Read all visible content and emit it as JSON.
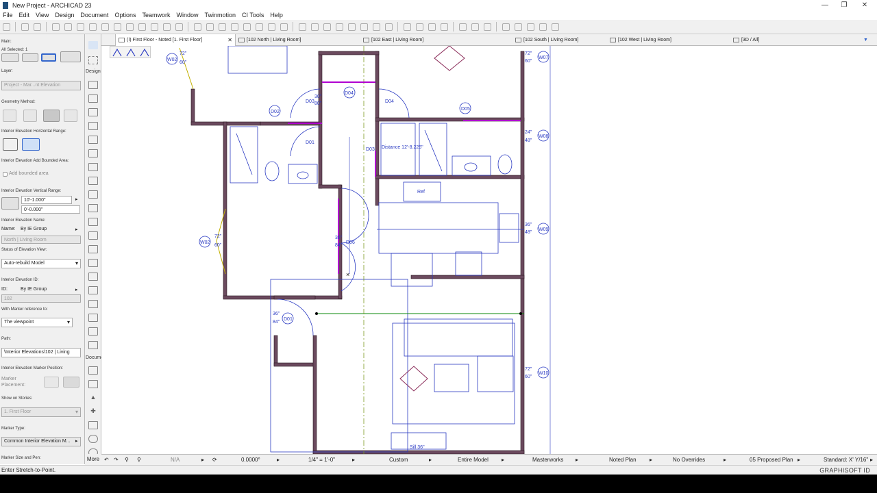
{
  "window": {
    "title": "New Project - ARCHICAD 23"
  },
  "menu": [
    "File",
    "Edit",
    "View",
    "Design",
    "Document",
    "Options",
    "Teamwork",
    "Window",
    "Twinmotion",
    "CI Tools",
    "Help"
  ],
  "infobox": {
    "main_label": "Main:",
    "selected": "All Selected: 1",
    "layer_label": "Layer:",
    "layer_value": "Project - Mar...nt Elevation",
    "geometry_label": "Geometry Method:",
    "horiz_range_label": "Interior Elevation Horizontal Range:",
    "add_bounded_label": "Interior Elevation Add Bounded Area:",
    "add_bounded_check": "Add bounded area",
    "vert_range_label": "Interior Elevation Vertical Range:",
    "vert_top": "10'-1.000\"",
    "vert_bottom": "0'-0.000\"",
    "name_label": "Interior Elevation Name:",
    "name_key": "Name:",
    "name_value": "By IE Group",
    "name_preview": "North | Living Room",
    "status_label": "Status of Elevation View:",
    "status_value": "Auto-rebuild Model",
    "id_label": "Interior Elevation ID:",
    "id_key": "ID:",
    "id_value": "By IE Group",
    "id_preview": "102",
    "marker_ref_label": "With Marker reference to:",
    "marker_ref_value": "The viewpoint",
    "path_label": "Path:",
    "path_value": "\\Interior Elevations\\102 | Living",
    "marker_pos_label": "Interior Elevation Marker Position:",
    "marker_placement": "Marker Placement:",
    "show_stories_label": "Show on Stories:",
    "show_stories_value": "1. First Floor",
    "marker_type_label": "Marker Type:",
    "marker_type_value": "Common Interior Elevation M...",
    "marker_size_label": "Marker Size and Pen:"
  },
  "toolbox": {
    "design_header": "Design",
    "document_header": "Docume",
    "more": "More"
  },
  "tabs": [
    {
      "label": "(I) First Floor - Noted [1. First Floor]",
      "active": true
    },
    {
      "label": "[102 North | Living Room]"
    },
    {
      "label": "[102 East | Living Room]"
    },
    {
      "label": "[102 South | Living Room]"
    },
    {
      "label": "[102 West | Living Room]"
    },
    {
      "label": "[3D / All]"
    }
  ],
  "drawing": {
    "tags": [
      "W02",
      "W02",
      "W07",
      "W08",
      "W09",
      "W10",
      "D02",
      "D03",
      "D04",
      "D04",
      "D05",
      "D01",
      "D06",
      "D01",
      "D03"
    ],
    "dims_72_60": "72\"",
    "dims_60": "60\"",
    "dims_30": "30\"",
    "dims_80": "80\"",
    "dims_24": "24\"",
    "dims_48": "48\"",
    "dims_36": "36\"",
    "dims_84": "84\"",
    "sill_label": "Sill 36\"",
    "sill_48": "Sill 48\"",
    "ref_label": "Ref",
    "distance_readout": "Distance  12'-8.226\""
  },
  "statusbar": {
    "na": "N/A",
    "angle": "0.0000°",
    "scale": "1/4\"  =  1'-0\"",
    "layer_combo": "Custom",
    "model_view": "Entire Model",
    "pen_set": "Masterworks",
    "view_type": "Noted Plan",
    "override": "No Overrides",
    "renovation": "05 Proposed Plan",
    "dimension": "Standard: X' Y/16\""
  },
  "hint": "Enter Stretch-to-Point.",
  "brand": "GRAPHISOFT ID",
  "colors": {
    "wall_fill": "#6b4a5e",
    "plan_blue": "#2a3ac2",
    "selection": "#b000d0",
    "green_line": "#0a8a0a"
  }
}
